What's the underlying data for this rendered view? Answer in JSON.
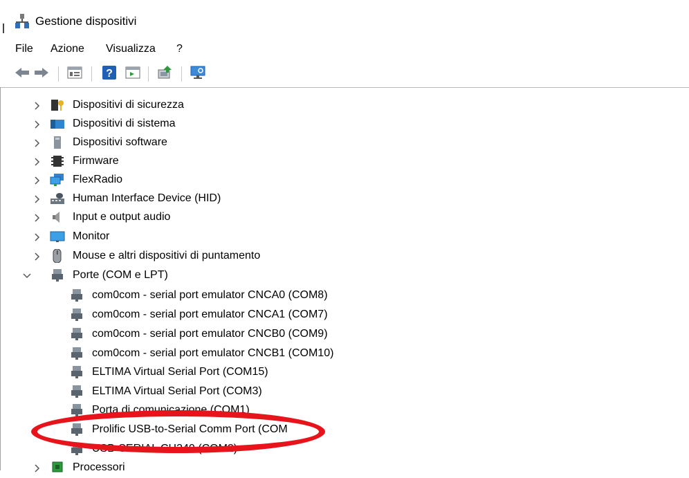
{
  "window": {
    "title": "Gestione dispositivi"
  },
  "menu": [
    "File",
    "Azione",
    "Visualizza",
    "?"
  ],
  "toolbar": {
    "buttons": [
      "back-arrow-icon",
      "forward-arrow-icon",
      "properties-grid-icon",
      "help-icon",
      "run-panel-icon",
      "update-driver-icon",
      "scan-hardware-icon"
    ]
  },
  "tree": {
    "categories": [
      {
        "label": "Dispositivi di sicurezza",
        "icon": "security-key-icon",
        "expanded": false
      },
      {
        "label": "Dispositivi di sistema",
        "icon": "system-folder-icon",
        "expanded": false
      },
      {
        "label": "Dispositivi software",
        "icon": "software-device-icon",
        "expanded": false
      },
      {
        "label": "Firmware",
        "icon": "firmware-chip-icon",
        "expanded": false
      },
      {
        "label": "FlexRadio",
        "icon": "network-monitor-icon",
        "expanded": false
      },
      {
        "label": "Human Interface Device (HID)",
        "icon": "hid-icon",
        "expanded": false
      },
      {
        "label": "Input e output audio",
        "icon": "speaker-icon",
        "expanded": false
      },
      {
        "label": "Monitor",
        "icon": "monitor-icon",
        "expanded": false
      },
      {
        "label": "Mouse e altri dispositivi di puntamento",
        "icon": "mouse-icon",
        "expanded": false
      },
      {
        "label": "Porte (COM e LPT)",
        "icon": "port-connector-icon",
        "expanded": true
      }
    ],
    "ports": [
      "com0com - serial port emulator CNCA0 (COM8)",
      "com0com - serial port emulator CNCA1 (COM7)",
      "com0com - serial port emulator CNCB0 (COM9)",
      "com0com - serial port emulator CNCB1 (COM10)",
      "ELTIMA Virtual Serial Port (COM15)",
      "ELTIMA Virtual Serial Port (COM3)",
      "Porta di comunicazione (COM1)",
      "Prolific USB-to-Serial Comm Port (COM",
      "USB-SERIAL CH340 (COM2)"
    ],
    "after": [
      {
        "label": "Processori",
        "icon": "processor-icon",
        "expanded": false
      }
    ]
  },
  "annotation": {
    "color": "#e8141c",
    "highlighted_item": "Prolific USB-to-Serial Comm Port (COM"
  }
}
